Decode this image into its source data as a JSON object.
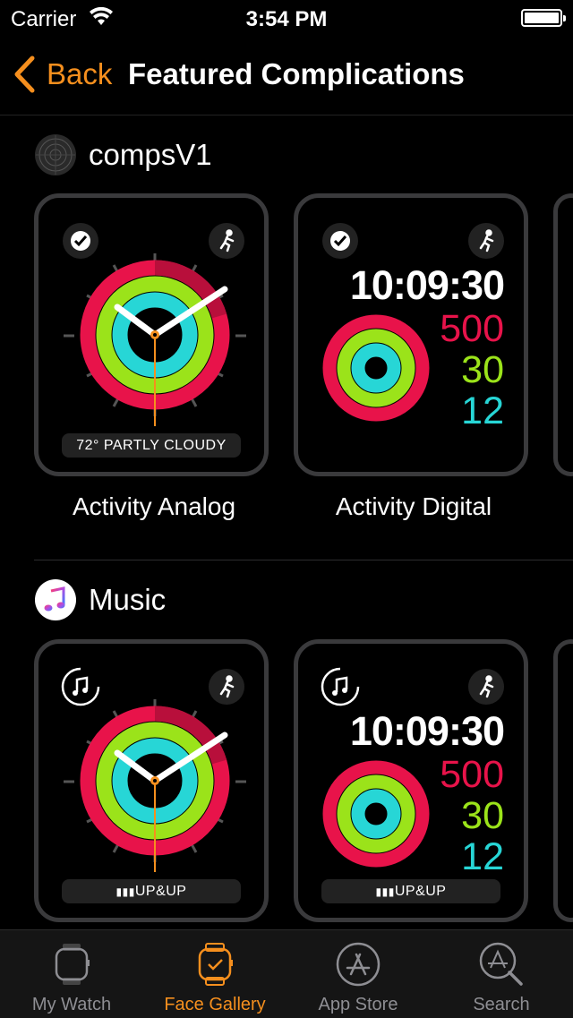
{
  "status": {
    "carrier": "Carrier",
    "time": "3:54 PM"
  },
  "nav": {
    "back_label": "Back",
    "title": "Featured Complications"
  },
  "sections": [
    {
      "app_name": "compsV1",
      "faces": [
        {
          "label": "Activity Analog",
          "complication": "72° PARTLY CLOUDY"
        },
        {
          "label": "Activity Digital",
          "time": "10:09:30",
          "move": "500",
          "exercise": "30",
          "stand": "12"
        }
      ]
    },
    {
      "app_name": "Music",
      "faces": [
        {
          "label": "",
          "complication": "UP&UP"
        },
        {
          "label": "",
          "time": "10:09:30",
          "move": "500",
          "exercise": "30",
          "stand": "12",
          "complication": "UP&UP"
        }
      ]
    }
  ],
  "tabs": [
    {
      "label": "My Watch",
      "icon": "watch-icon"
    },
    {
      "label": "Face Gallery",
      "icon": "face-gallery-icon",
      "active": true
    },
    {
      "label": "App Store",
      "icon": "app-store-icon"
    },
    {
      "label": "Search",
      "icon": "search-icon"
    }
  ],
  "colors": {
    "accent": "#f58f1e",
    "move": "#e8134a",
    "exercise": "#9be31a",
    "stand": "#27d6d6"
  }
}
